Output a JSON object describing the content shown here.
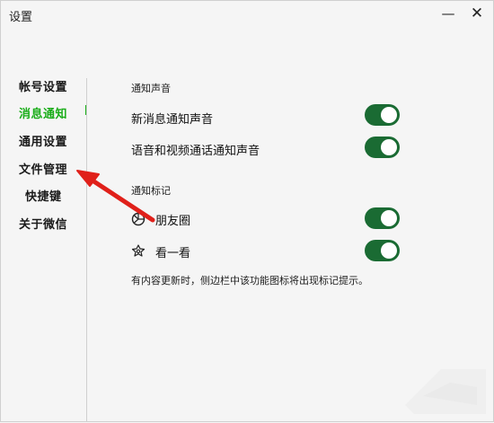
{
  "window": {
    "title": "设置",
    "minimize": "—",
    "close": "✕"
  },
  "sidebar": {
    "items": [
      {
        "label": "帐号设置"
      },
      {
        "label": "消息通知"
      },
      {
        "label": "通用设置"
      },
      {
        "label": "文件管理"
      },
      {
        "label": "快捷键"
      },
      {
        "label": "关于微信"
      }
    ],
    "active_index": 1
  },
  "main": {
    "section_sound": "通知声音",
    "rows_sound": [
      {
        "label": "新消息通知声音",
        "enabled": true
      },
      {
        "label": "语音和视频通话通知声音",
        "enabled": true
      }
    ],
    "section_badge": "通知标记",
    "rows_badge": [
      {
        "label": "朋友圈",
        "icon": "moments-icon",
        "enabled": true
      },
      {
        "label": "看一看",
        "icon": "top-stories-icon",
        "enabled": true
      }
    ],
    "hint": "有内容更新时，侧边栏中该功能图标将出现标记提示。"
  },
  "colors": {
    "accent": "#1aad19",
    "toggle_on": "#1a6b33",
    "annotation_arrow": "#e0201a"
  }
}
